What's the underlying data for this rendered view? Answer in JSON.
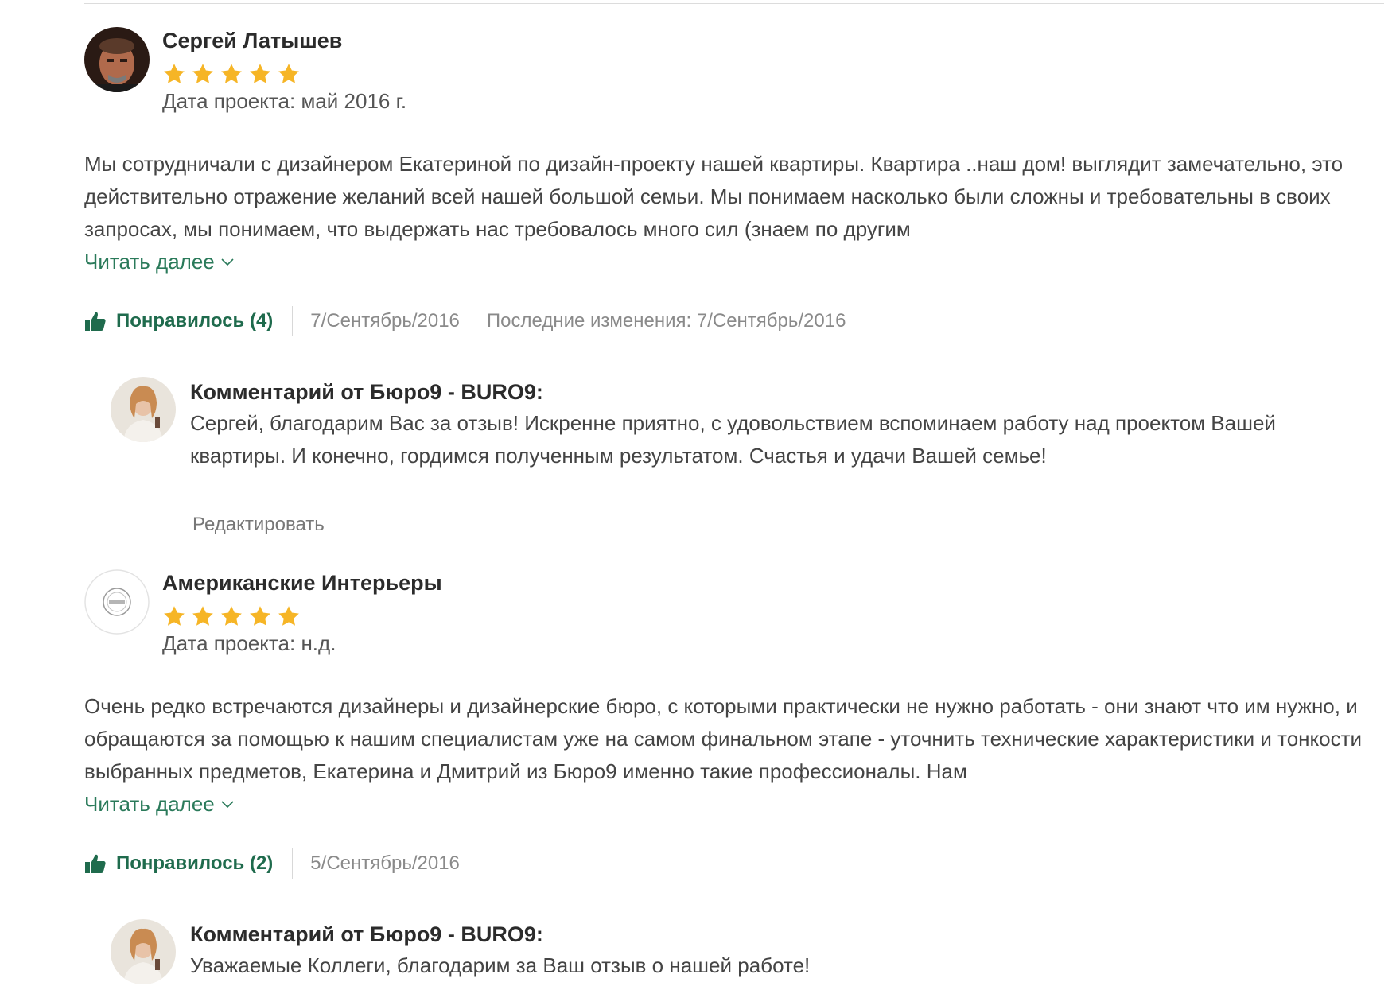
{
  "colors": {
    "star": "#f6b526",
    "accent_green": "#1f6b4d",
    "link_green": "#2a7a5a",
    "meta_gray": "#8a8a8a",
    "divider": "#dcdcdc"
  },
  "reviews": [
    {
      "author": "Сергей Латышев",
      "rating": 5,
      "rating_max": 5,
      "project_date": "Дата проекта: май 2016 г.",
      "text": "Мы сотрудничали с дизайнером Екатериной по дизайн-проекту нашей квартиры. Квартира ..наш дом! выглядит замечательно, это действительно отражение желаний всей нашей большой семьи. Мы понимаем насколько были сложны и требовательны в своих запросах, мы понимаем, что выдержать нас требовалось много сил (знаем по другим",
      "read_more": "Читать далее",
      "like_label": "Понравилось (4)",
      "date": "7/Сентябрь/2016",
      "modified": "Последние изменения:  7/Сентябрь/2016",
      "comment": {
        "title": "Комментарий от Бюро9 - BURO9:",
        "text": "Сергей, благодарим Вас за отзыв! Искренне приятно, с удовольствием вспоминаем работу над проектом Вашей квартиры. И конечно, гордимся полученным результатом. Счастья и удачи Вашей семье!",
        "edit_label": "Редактировать"
      }
    },
    {
      "author": "Американские Интерьеры",
      "rating": 5,
      "rating_max": 5,
      "project_date": "Дата проекта: н.д.",
      "text": "Очень редко встречаются дизайнеры и дизайнерские бюро, с которыми практически не нужно работать - они знают что им нужно, и обращаются за помощью к нашим специалистам уже на самом финальном этапе - уточнить технические характеристики и тонкости выбранных предметов, Екатерина и Дмитрий из Бюро9 именно такие профессионалы. Нам",
      "read_more": "Читать далее",
      "like_label": "Понравилось (2)",
      "date": "5/Сентябрь/2016",
      "comment": {
        "title": "Комментарий от Бюро9 - BURO9:",
        "text": "Уважаемые Коллеги, благодарим за Ваш отзыв о нашей работе!"
      }
    }
  ]
}
